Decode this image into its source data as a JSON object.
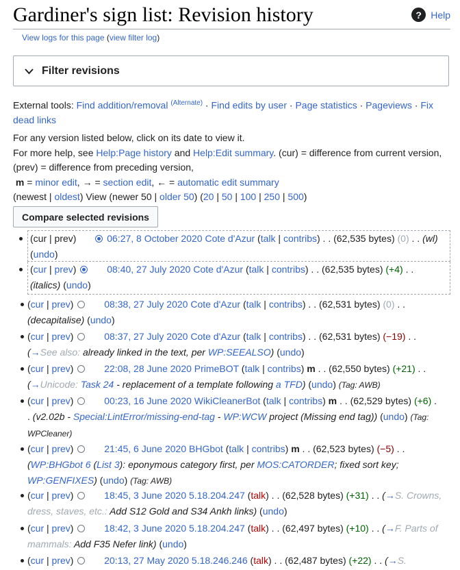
{
  "page": {
    "title": "Gardiner's sign list: Revision history",
    "help_label": "Help",
    "sub_links": {
      "view_logs": "View logs for this page",
      "filter_log": "view filter log"
    }
  },
  "filter": {
    "label": "Filter revisions"
  },
  "tools": {
    "prefix": "External tools:",
    "find_add_remove": "Find addition/removal",
    "alternate": "(Alternate)",
    "find_edits_user": "Find edits by user",
    "page_stats": "Page statistics",
    "pageviews": "Pageviews",
    "fix_dead_links": "Fix dead links"
  },
  "help_text": {
    "line1": "For any version listed below, click on its date to view it.",
    "line2_prefix": "For more help, see",
    "help_page_history": "Help:Page history",
    "and": "and",
    "help_edit_summary": "Help:Edit summary",
    "line2_suffix": ". (cur) = difference from current version, (prev) = difference from preceding version,",
    "m_label": "m",
    "minor_edit": "minor edit",
    "section_arrow": "→",
    "section_edit": "section edit",
    "auto_arrow": "←",
    "auto_summary": "automatic edit summary"
  },
  "nav": {
    "newest": "newest",
    "oldest": "oldest",
    "view_text": "View",
    "newer": "newer 50",
    "older": "older 50",
    "counts": [
      "20",
      "50",
      "100",
      "250",
      "500"
    ]
  },
  "compare_button": "Compare selected revisions",
  "revisions": [
    {
      "date": "06:27, 8 October 2020",
      "user": "Cote d'Azur",
      "size": "(62,535 bytes)",
      "diff": "(0)",
      "summary": "(wl)",
      "undo": "undo"
    },
    {
      "date": "08:40, 27 July 2020",
      "user": "Cote d'Azur",
      "size": "(62,535 bytes)",
      "diff": "(+4)",
      "summary": "(italics)",
      "undo": "undo"
    },
    {
      "date": "08:38, 27 July 2020",
      "user": "Cote d'Azur",
      "size": "(62,531 bytes)",
      "diff": "(0)",
      "summary": "(decapitalise)",
      "undo": "undo"
    },
    {
      "date": "08:37, 27 July 2020",
      "user": "Cote d'Azur",
      "size": "(62,531 bytes)",
      "diff": "(−19)",
      "summary_section": "See also:",
      "summary": "already linked in the text, per",
      "summary_link": "WP:SEEALSO",
      "undo": "undo"
    },
    {
      "date": "22:08, 28 June 2020",
      "user": "PrimeBOT",
      "size": "(62,550 bytes)",
      "diff": "(+21)",
      "summary_section": "Unicode:",
      "summary_link": "Task 24",
      "summary": "- replacement of a template following",
      "summary_link2": "a TFD",
      "undo": "undo",
      "tag": "(Tag: AWB)"
    },
    {
      "date": "00:23, 16 June 2020",
      "user": "WikiCleanerBot",
      "size": "(62,529 bytes)",
      "diff": "(+6)",
      "summary": "(v2.02b -",
      "summary_link": "Special:LintError/missing-end-tag",
      "summary_mid": "-",
      "summary_link2": "WP:WCW",
      "summary_end": "project (Missing end tag))",
      "undo": "undo",
      "tag": "(Tag: WPCleaner)"
    },
    {
      "date": "21:45, 6 June 2020",
      "user": "BHGbot",
      "size": "(62,523 bytes)",
      "diff": "(−5)",
      "summary_link": "WP:BHGbot 6",
      "summary_link2": "List 3",
      "summary": "eponymous category first, per",
      "summary_link3": "MOS:CATORDER",
      "summary_end": "; fixed sort key;",
      "summary_link4": "WP:GENFIXES",
      "undo": "undo",
      "tag": "(Tag: AWB)"
    },
    {
      "date": "18:45, 3 June 2020",
      "user": "5.18.204.247",
      "size": "(62,528 bytes)",
      "diff": "(+31)",
      "summary_section": "S. Crowns, dress, staves, etc.:",
      "summary": "Add S12 Gold and S34 Ankh links",
      "undo": "undo"
    },
    {
      "date": "18:42, 3 June 2020",
      "user": "5.18.204.247",
      "size": "(62,497 bytes)",
      "diff": "(+10)",
      "summary_section": "F. Parts of mammals:",
      "summary": "Add F35 Nefer link",
      "undo": "undo"
    },
    {
      "date": "20:13, 27 May 2020",
      "user": "5.18.246.246",
      "size": "(62,487 bytes)",
      "diff": "(+22)",
      "summary_section": "S."
    }
  ],
  "labels": {
    "cur": "cur",
    "prev": "prev",
    "talk": "talk",
    "contribs": "contribs",
    "m": "m"
  }
}
